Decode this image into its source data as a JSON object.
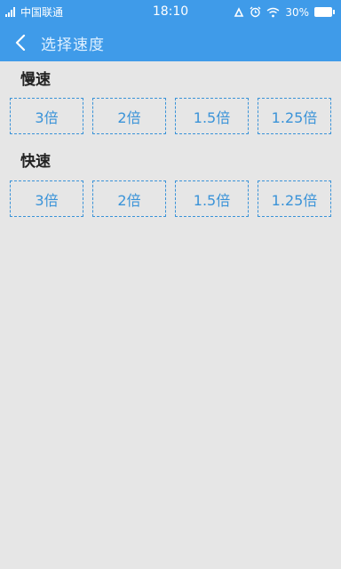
{
  "status_bar": {
    "carrier": "中国联通",
    "time": "18:10",
    "battery": "30%"
  },
  "toolbar": {
    "title": "选择速度"
  },
  "sections": [
    {
      "title": "慢速",
      "options": [
        "3倍",
        "2倍",
        "1.5倍",
        "1.25倍"
      ]
    },
    {
      "title": "快速",
      "options": [
        "3倍",
        "2倍",
        "1.5倍",
        "1.25倍"
      ]
    }
  ],
  "colors": {
    "accent": "#3f9be9",
    "option_border": "#3a93d8",
    "background": "#e6e6e6"
  }
}
